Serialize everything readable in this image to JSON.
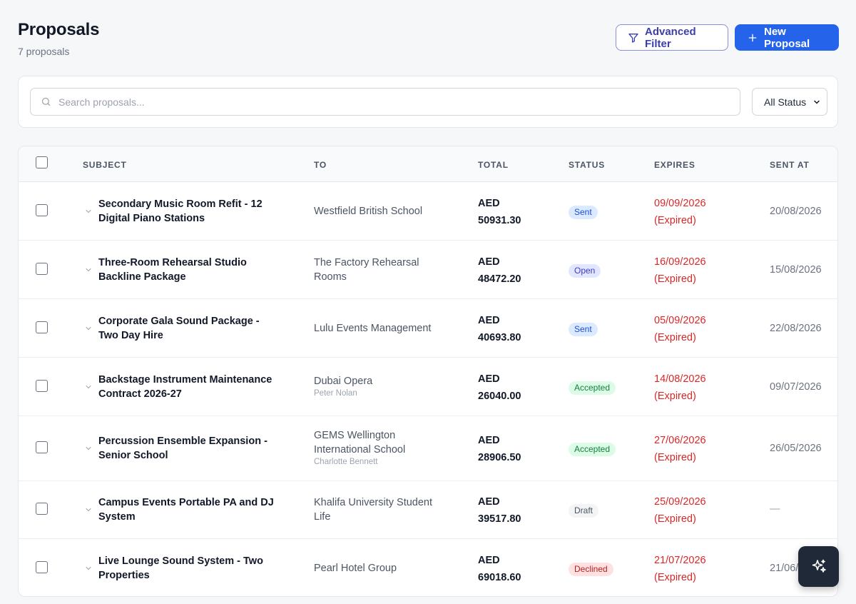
{
  "header": {
    "title": "Proposals",
    "count": "7 proposals",
    "advanced_filter_label": "Advanced Filter",
    "new_proposal_label": "New Proposal"
  },
  "search": {
    "placeholder": "Search proposals...",
    "status_filter": "All Status"
  },
  "table": {
    "columns": [
      "SUBJECT",
      "TO",
      "TOTAL",
      "STATUS",
      "EXPIRES",
      "SENT AT"
    ],
    "rows": [
      {
        "subject": "Secondary Music Room Refit - 12 Digital Piano Stations",
        "to": "Westfield British School",
        "to_contact": "",
        "currency": "AED",
        "amount": "50931.30",
        "status": "Sent",
        "expires": "09/09/2026",
        "expired_note": "(Expired)",
        "sent_at": "20/08/2026"
      },
      {
        "subject": "Three-Room Rehearsal Studio Backline Package",
        "to": "The Factory Rehearsal Rooms",
        "to_contact": "",
        "currency": "AED",
        "amount": "48472.20",
        "status": "Open",
        "expires": "16/09/2026",
        "expired_note": "(Expired)",
        "sent_at": "15/08/2026"
      },
      {
        "subject": "Corporate Gala Sound Package - Two Day Hire",
        "to": "Lulu Events Management",
        "to_contact": "",
        "currency": "AED",
        "amount": "40693.80",
        "status": "Sent",
        "expires": "05/09/2026",
        "expired_note": "(Expired)",
        "sent_at": "22/08/2026"
      },
      {
        "subject": "Backstage Instrument Maintenance Contract 2026-27",
        "to": "Dubai Opera",
        "to_contact": "Peter Nolan",
        "currency": "AED",
        "amount": "26040.00",
        "status": "Accepted",
        "expires": "14/08/2026",
        "expired_note": "(Expired)",
        "sent_at": "09/07/2026"
      },
      {
        "subject": "Percussion Ensemble Expansion - Senior School",
        "to": "GEMS Wellington International School",
        "to_contact": "Charlotte Bennett",
        "currency": "AED",
        "amount": "28906.50",
        "status": "Accepted",
        "expires": "27/06/2026",
        "expired_note": "(Expired)",
        "sent_at": "26/05/2026"
      },
      {
        "subject": "Campus Events Portable PA and DJ System",
        "to": "Khalifa University Student Life",
        "to_contact": "",
        "currency": "AED",
        "amount": "39517.80",
        "status": "Draft",
        "expires": "25/09/2026",
        "expired_note": "(Expired)",
        "sent_at": "—"
      },
      {
        "subject": "Live Lounge Sound System - Two Properties",
        "to": "Pearl Hotel Group",
        "to_contact": "",
        "currency": "AED",
        "amount": "69018.60",
        "status": "Declined",
        "expires": "21/07/2026",
        "expired_note": "(Expired)",
        "sent_at": "21/06/"
      }
    ]
  },
  "colors": {
    "primary": "#2563eb",
    "expired": "#dc2626"
  }
}
